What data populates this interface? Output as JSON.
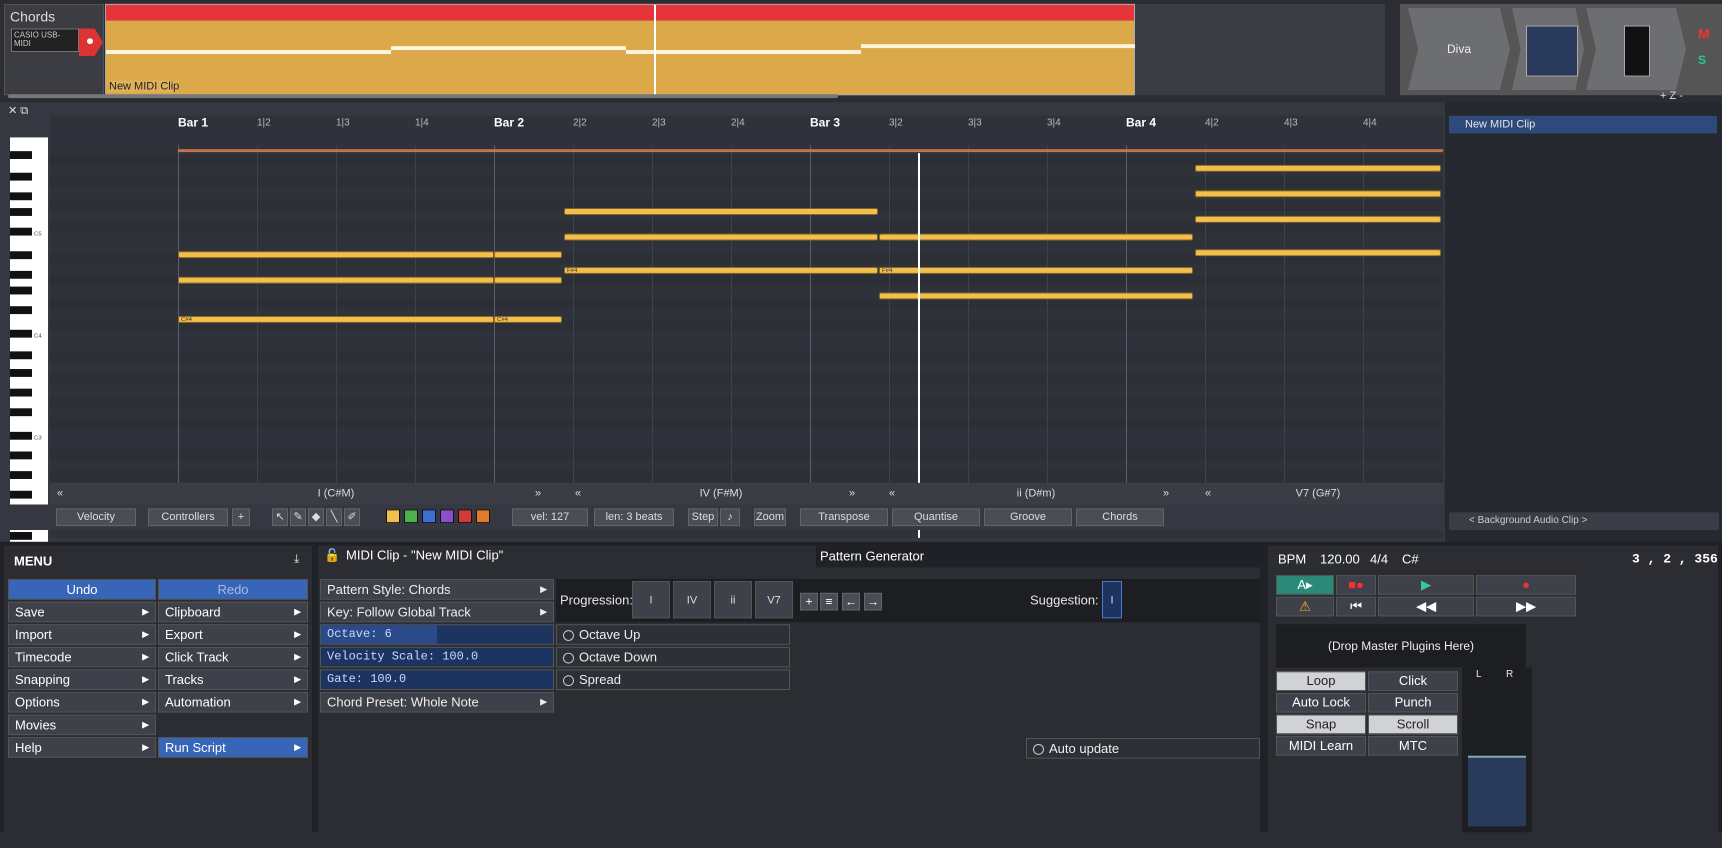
{
  "track": {
    "name": "Chords",
    "midi_input": "CASIO USB-MIDI",
    "clip_name": "New MIDI Clip",
    "plugin_name": "Diva",
    "mute": "M",
    "solo": "S"
  },
  "piano_roll": {
    "bars": [
      "Bar 1",
      "Bar 2",
      "Bar 3",
      "Bar 4"
    ],
    "beats": [
      "1|2",
      "1|3",
      "1|4",
      "2|2",
      "2|3",
      "2|4",
      "3|2",
      "3|3",
      "3|4",
      "4|2",
      "4|3",
      "4|4"
    ],
    "key_labels": [
      "C5",
      "C4",
      "C3"
    ],
    "note_labels": {
      "cs4": "C#4",
      "fs4": "F#4"
    },
    "chords": [
      "I (C#M)",
      "IV (F#M)",
      "ii (D#m)",
      "V7 (G#7)"
    ],
    "clip_list_item": "New MIDI Clip",
    "background_audio": "< Background Audio Clip >"
  },
  "toolbar": {
    "velocity": "Velocity",
    "controllers": "Controllers",
    "plus": "+",
    "vel": "vel: 127",
    "len": "len: 3 beats",
    "step": "Step",
    "zoom": "Zoom",
    "transpose": "Transpose",
    "quantise": "Quantise",
    "groove": "Groove",
    "chords": "Chords",
    "swatches": [
      "#f2be4e",
      "#4caf50",
      "#3b6fd4",
      "#8a4fc9",
      "#d23a3a",
      "#e07b2a"
    ]
  },
  "menu": {
    "title": "MENU",
    "undo": "Undo",
    "redo": "Redo",
    "left": [
      "Save",
      "Import",
      "Timecode",
      "Snapping",
      "Options",
      "Movies",
      "Help"
    ],
    "right": [
      "Clipboard",
      "Export",
      "Click Track",
      "Tracks",
      "Automation",
      "Run Script"
    ]
  },
  "clip_panel": {
    "title": "MIDI Clip - \"New MIDI Clip\"",
    "tab": "Pattern Generator",
    "pattern_style": "Pattern Style: Chords",
    "key": "Key: Follow Global Track",
    "octave": "Octave: 6",
    "velocity_scale": "Velocity Scale: 100.0",
    "gate": "Gate: 100.0",
    "octave_fill": 0.5,
    "chord_preset": "Chord Preset: Whole Note",
    "progression_label": "Progression:",
    "progression": [
      "I",
      "IV",
      "ii",
      "V7"
    ],
    "suggestion_label": "Suggestion:",
    "suggestion": "I",
    "octave_up": "Octave Up",
    "octave_down": "Octave Down",
    "spread": "Spread",
    "auto_update": "Auto update"
  },
  "transport": {
    "bpm_label": "BPM",
    "bpm": "120.00",
    "time_sig": "4/4",
    "key": "C#",
    "position": "3 , 2 , 356",
    "master_drop": "(Drop Master Plugins Here)",
    "loop": "Loop",
    "click": "Click",
    "auto_lock": "Auto Lock",
    "punch": "Punch",
    "snap": "Snap",
    "scroll": "Scroll",
    "midi_learn": "MIDI Learn",
    "mtc": "MTC",
    "meter_l": "L",
    "meter_r": "R"
  }
}
